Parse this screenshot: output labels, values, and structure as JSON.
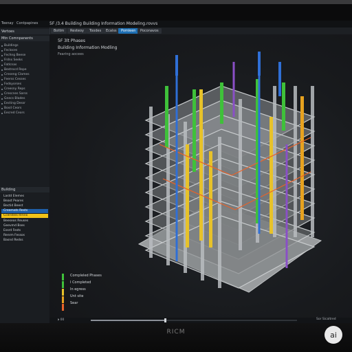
{
  "window": {
    "title": "5F /3.4 Building Building Information Modeling.rovvs",
    "brand": "RICM",
    "badge": "ai"
  },
  "menubar": [
    "Teenay",
    "Contpapines"
  ],
  "tabs": [
    {
      "label": "Bottm",
      "active": false
    },
    {
      "label": "Resteoy",
      "active": false
    },
    {
      "label": "Toodes",
      "active": false
    },
    {
      "label": "Ecalss",
      "active": false
    },
    {
      "label": "Pomleen",
      "active": true
    },
    {
      "label": "Poconavos",
      "active": false
    }
  ],
  "left_panel": {
    "header1": "Vertoes",
    "header2": "Mtn Comnpanents",
    "items": [
      "Buildings",
      "Fecloces",
      "Fechng Beese",
      "Frdns Seeks",
      "Fatlcnas",
      "Bestrocd Repe",
      "Creseng Clames",
      "Feerss Cesses",
      "Fedsyorses",
      "Creesny Reps",
      "Crescnes Sarss",
      "Gnecs Blades",
      "Eecting Dessr",
      "Bosd Ceors",
      "Eecred Ceors"
    ],
    "layers_header": "Building",
    "layers": [
      {
        "label": "Lastd Elemes",
        "style": "normal"
      },
      {
        "label": "Beast Peares",
        "style": "normal"
      },
      {
        "label": "Bectid Beest",
        "style": "normal"
      },
      {
        "label": "Creemats Rests",
        "style": "blue"
      },
      {
        "label": "Ccerstnls Rrnns",
        "style": "hl"
      },
      {
        "label": "Beeseos Reuses",
        "style": "normal"
      },
      {
        "label": "Geevmd Bses",
        "style": "normal"
      },
      {
        "label": "Essrd Fests",
        "style": "normal"
      },
      {
        "label": "Renrm Fessos",
        "style": "normal"
      },
      {
        "label": "Basnd Redss",
        "style": "normal"
      }
    ]
  },
  "viewport": {
    "title_line1": "5F 3lt Phases",
    "title_line2": "Building Information Modling",
    "title_line3": "Fearing aocees",
    "legend": [
      {
        "label": "Compleled Phases",
        "color": "#3fc13a"
      },
      {
        "label": "I Completed",
        "color": "#3fc13a"
      },
      {
        "label": "In egress",
        "color": "#e7c22a"
      },
      {
        "label": "Unt site",
        "color": "#e7a21f"
      },
      {
        "label": "Sear",
        "color": "#e8632a"
      }
    ]
  },
  "timeline": {
    "left_label": "⏵ 00",
    "right_label": "Sor Sicaltred",
    "progress": 0.36
  },
  "colors": {
    "accent_blue": "#1e6fb3",
    "highlight_yellow": "#f2c318",
    "phase_green": "#3fc13a",
    "phase_yellow": "#e7c22a",
    "phase_orange": "#e7a21f",
    "phase_red": "#e8632a",
    "crane_blue": "#2f6fd6",
    "crane_purple": "#8a4fc7"
  }
}
